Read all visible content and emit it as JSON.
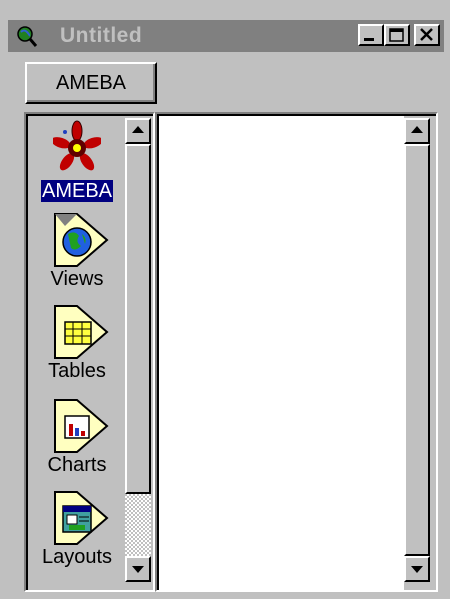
{
  "window": {
    "title": "Untitled"
  },
  "toolbar": {
    "project_button_label": "AMEBA"
  },
  "sidebar": {
    "items": [
      {
        "label": "AMEBA",
        "icon": "ameba-star-icon",
        "selected": true
      },
      {
        "label": "Views",
        "icon": "globe-document-icon",
        "selected": false
      },
      {
        "label": "Tables",
        "icon": "table-document-icon",
        "selected": false
      },
      {
        "label": "Charts",
        "icon": "chart-document-icon",
        "selected": false
      },
      {
        "label": "Layouts",
        "icon": "layout-document-icon",
        "selected": false
      }
    ]
  },
  "colors": {
    "face": "#c0c0c0",
    "title_inactive": "#808080",
    "selection": "#000080",
    "document_icon": "#ffffc0"
  }
}
